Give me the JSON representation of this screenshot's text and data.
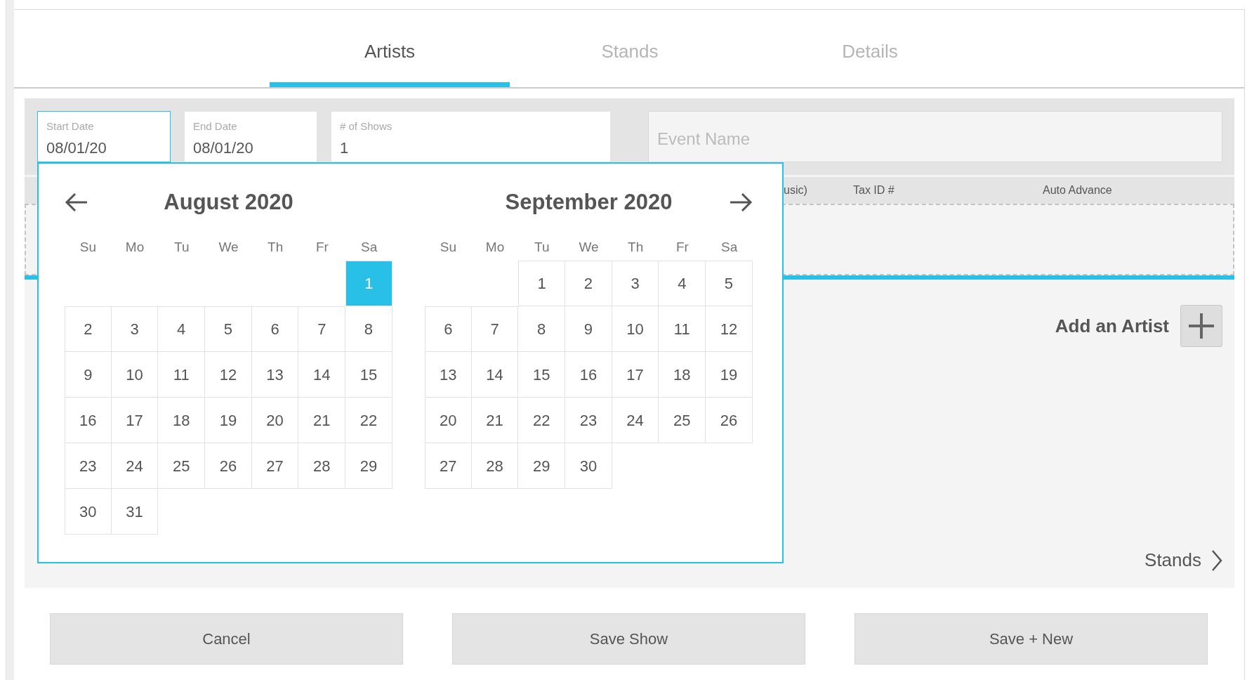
{
  "tabs": [
    {
      "label": "Artists",
      "selected": true
    },
    {
      "label": "Stands",
      "selected": false
    },
    {
      "label": "Details",
      "selected": false
    }
  ],
  "fields": [
    {
      "label": "Start Date",
      "value": "08/01/20",
      "focused": true
    },
    {
      "label": "End Date",
      "value": "08/01/20",
      "focused": false
    },
    {
      "label": "# of Shows",
      "value": "1",
      "focused": false
    }
  ],
  "event_name": {
    "placeholder": "Event Name"
  },
  "table": {
    "columns": [
      "usic)",
      "Tax ID #",
      "Auto Advance"
    ]
  },
  "add_artist": {
    "label": "Add an Artist"
  },
  "next_link": {
    "label": "Stands"
  },
  "calendar": {
    "months": [
      {
        "title": "August 2020",
        "weekdays": [
          "Su",
          "Mo",
          "Tu",
          "We",
          "Th",
          "Fr",
          "Sa"
        ],
        "weeks": [
          [
            {
              "kind": "blank"
            },
            {
              "kind": "blank"
            },
            {
              "kind": "blank"
            },
            {
              "kind": "blank"
            },
            {
              "kind": "blank"
            },
            {
              "kind": "blank"
            },
            {
              "day": "1",
              "selected": true
            }
          ],
          [
            {
              "day": "2",
              "selected": false
            },
            {
              "day": "3",
              "selected": false
            },
            {
              "day": "4",
              "selected": false
            },
            {
              "day": "5",
              "selected": false
            },
            {
              "day": "6",
              "selected": false
            },
            {
              "day": "7",
              "selected": false
            },
            {
              "day": "8",
              "selected": false
            }
          ],
          [
            {
              "day": "9",
              "selected": false
            },
            {
              "day": "10",
              "selected": false
            },
            {
              "day": "11",
              "selected": false
            },
            {
              "day": "12",
              "selected": false
            },
            {
              "day": "13",
              "selected": false
            },
            {
              "day": "14",
              "selected": false
            },
            {
              "day": "15",
              "selected": false
            }
          ],
          [
            {
              "day": "16",
              "selected": false
            },
            {
              "day": "17",
              "selected": false
            },
            {
              "day": "18",
              "selected": false
            },
            {
              "day": "19",
              "selected": false
            },
            {
              "day": "20",
              "selected": false
            },
            {
              "day": "21",
              "selected": false
            },
            {
              "day": "22",
              "selected": false
            }
          ],
          [
            {
              "day": "23",
              "selected": false
            },
            {
              "day": "24",
              "selected": false
            },
            {
              "day": "25",
              "selected": false
            },
            {
              "day": "26",
              "selected": false
            },
            {
              "day": "27",
              "selected": false
            },
            {
              "day": "28",
              "selected": false
            },
            {
              "day": "29",
              "selected": false
            }
          ],
          [
            {
              "day": "30",
              "selected": false
            },
            {
              "day": "31",
              "selected": false
            },
            {
              "kind": "blank"
            },
            {
              "kind": "blank"
            },
            {
              "kind": "blank"
            },
            {
              "kind": "blank"
            },
            {
              "kind": "blank"
            }
          ]
        ]
      },
      {
        "title": "September 2020",
        "weekdays": [
          "Su",
          "Mo",
          "Tu",
          "We",
          "Th",
          "Fr",
          "Sa"
        ],
        "weeks": [
          [
            {
              "kind": "blank"
            },
            {
              "kind": "blank"
            },
            {
              "day": "1",
              "selected": false
            },
            {
              "day": "2",
              "selected": false
            },
            {
              "day": "3",
              "selected": false
            },
            {
              "day": "4",
              "selected": false
            },
            {
              "day": "5",
              "selected": false
            }
          ],
          [
            {
              "day": "6",
              "selected": false
            },
            {
              "day": "7",
              "selected": false
            },
            {
              "day": "8",
              "selected": false
            },
            {
              "day": "9",
              "selected": false
            },
            {
              "day": "10",
              "selected": false
            },
            {
              "day": "11",
              "selected": false
            },
            {
              "day": "12",
              "selected": false
            }
          ],
          [
            {
              "day": "13",
              "selected": false
            },
            {
              "day": "14",
              "selected": false
            },
            {
              "day": "15",
              "selected": false
            },
            {
              "day": "16",
              "selected": false
            },
            {
              "day": "17",
              "selected": false
            },
            {
              "day": "18",
              "selected": false
            },
            {
              "day": "19",
              "selected": false
            }
          ],
          [
            {
              "day": "20",
              "selected": false
            },
            {
              "day": "21",
              "selected": false
            },
            {
              "day": "22",
              "selected": false
            },
            {
              "day": "23",
              "selected": false
            },
            {
              "day": "24",
              "selected": false
            },
            {
              "day": "25",
              "selected": false
            },
            {
              "day": "26",
              "selected": false
            }
          ],
          [
            {
              "day": "27",
              "selected": false
            },
            {
              "day": "28",
              "selected": false
            },
            {
              "day": "29",
              "selected": false
            },
            {
              "day": "30",
              "selected": false
            },
            {
              "kind": "blank"
            },
            {
              "kind": "blank"
            },
            {
              "kind": "blank"
            }
          ]
        ]
      }
    ]
  },
  "buttons": [
    "Cancel",
    "Save Show",
    "Save + New"
  ]
}
